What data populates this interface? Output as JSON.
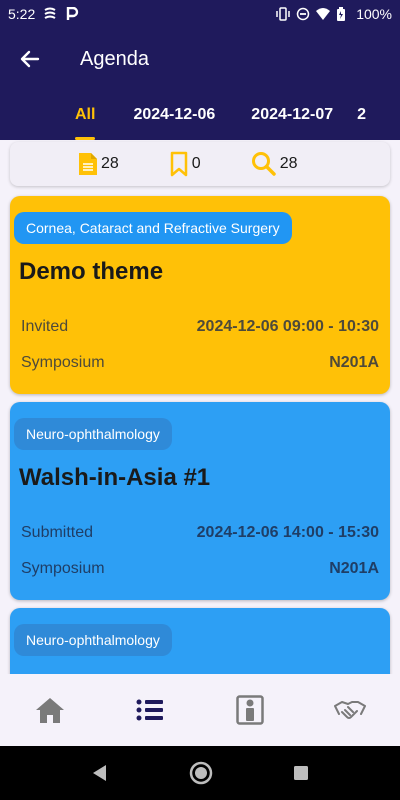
{
  "status_bar": {
    "time": "5:22",
    "battery": "100%"
  },
  "app_bar": {
    "title": "Agenda"
  },
  "tabs": [
    {
      "label": "All"
    },
    {
      "label": "2024-12-06"
    },
    {
      "label": "2024-12-07"
    },
    {
      "label": "2"
    }
  ],
  "stats": {
    "documents": "28",
    "bookmarks": "0",
    "search": "28"
  },
  "cards": [
    {
      "category": "Cornea, Cataract and Refractive Surgery",
      "title": "Demo theme",
      "status": "Invited",
      "datetime": "2024-12-06 09:00 - 10:30",
      "type": "Symposium",
      "room": "N201A",
      "color": "#ffc107"
    },
    {
      "category": "Neuro-ophthalmology",
      "title": "Walsh-in-Asia #1",
      "status": "Submitted",
      "datetime": "2024-12-06 14:00 - 15:30",
      "type": "Symposium",
      "room": "N201A",
      "color": "#2d9ff4"
    },
    {
      "category": "Neuro-ophthalmology",
      "color": "#2d9ff4"
    }
  ],
  "bottom_nav": [
    {
      "icon": "home-icon"
    },
    {
      "icon": "list-icon"
    },
    {
      "icon": "person-info-icon"
    },
    {
      "icon": "handshake-icon"
    }
  ],
  "colors": {
    "primary": "#1f1a5c",
    "accent": "#ffc107",
    "card_blue": "#2d9ff4"
  }
}
